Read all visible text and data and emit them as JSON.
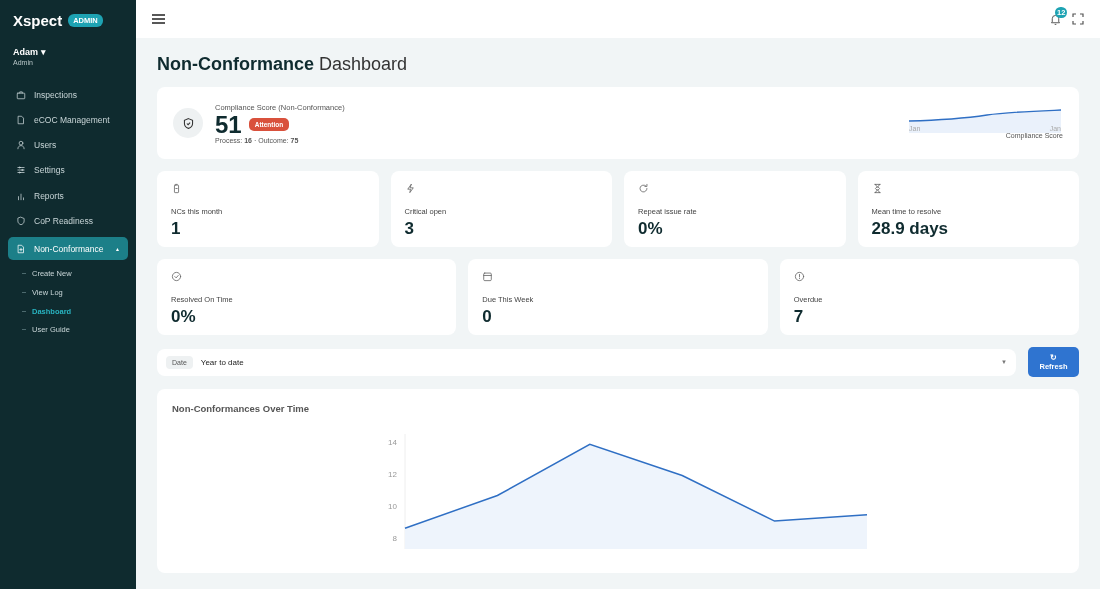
{
  "sidebar": {
    "brand": "Xspect",
    "badge": "ADMIN",
    "user": {
      "name": "Adam ▾",
      "role": "Admin"
    },
    "items": [
      {
        "label": "Inspections",
        "selected": false
      },
      {
        "label": "eCOC Management",
        "selected": false
      },
      {
        "label": "Users",
        "selected": false
      },
      {
        "label": "Settings",
        "selected": false
      },
      {
        "label": "Reports",
        "selected": false
      },
      {
        "label": "CoP Readiness",
        "selected": false
      },
      {
        "label": "Non-Conformance",
        "selected": true,
        "expanded": true,
        "caret": "▲",
        "children": [
          {
            "label": "Create New",
            "selected": false
          },
          {
            "label": "View Log",
            "selected": false
          },
          {
            "label": "Dashboard",
            "selected": true
          },
          {
            "label": "User Guide",
            "selected": false
          }
        ]
      }
    ]
  },
  "topbar": {
    "notifications": "12"
  },
  "title": {
    "bold": "Non-Conformance",
    "rest": "Dashboard"
  },
  "compliance": {
    "label": "Compliance Score (Non-Conformance)",
    "score": "51",
    "status": "Attention",
    "breakdown": "Process: **16** · Outcome: **75**",
    "spark_start": "Jan",
    "spark_end": "Jan",
    "spark_caption": "Compliance Score"
  },
  "stats_row_1": [
    {
      "label": "NCs this month",
      "value": "1"
    },
    {
      "label": "Critical open",
      "value": "3"
    },
    {
      "label": "Repeat issue rate",
      "value": "0%"
    },
    {
      "label": "Mean time to resolve",
      "value": "28.9 days"
    }
  ],
  "stats_row_2": [
    {
      "label": "Resolved On Time",
      "value": "0%"
    },
    {
      "label": "Due This Week",
      "value": "0"
    },
    {
      "label": "Overdue",
      "value": "7"
    }
  ],
  "filter": {
    "label": "Date",
    "value": "Year to date",
    "caret": "▼",
    "button_icon": "↻",
    "button": "Refresh"
  },
  "chart": {
    "title": "Non-Conformances Over Time",
    "chart_data": {
      "type": "area",
      "yticks": [
        8,
        10,
        12,
        14
      ],
      "ylim": [
        7.3,
        14.5
      ],
      "series": [
        {
          "color": "#2f6fc4",
          "values": [
            8.6,
            10.65,
            13.85,
            11.9,
            9.05,
            9.45
          ]
        }
      ]
    }
  }
}
